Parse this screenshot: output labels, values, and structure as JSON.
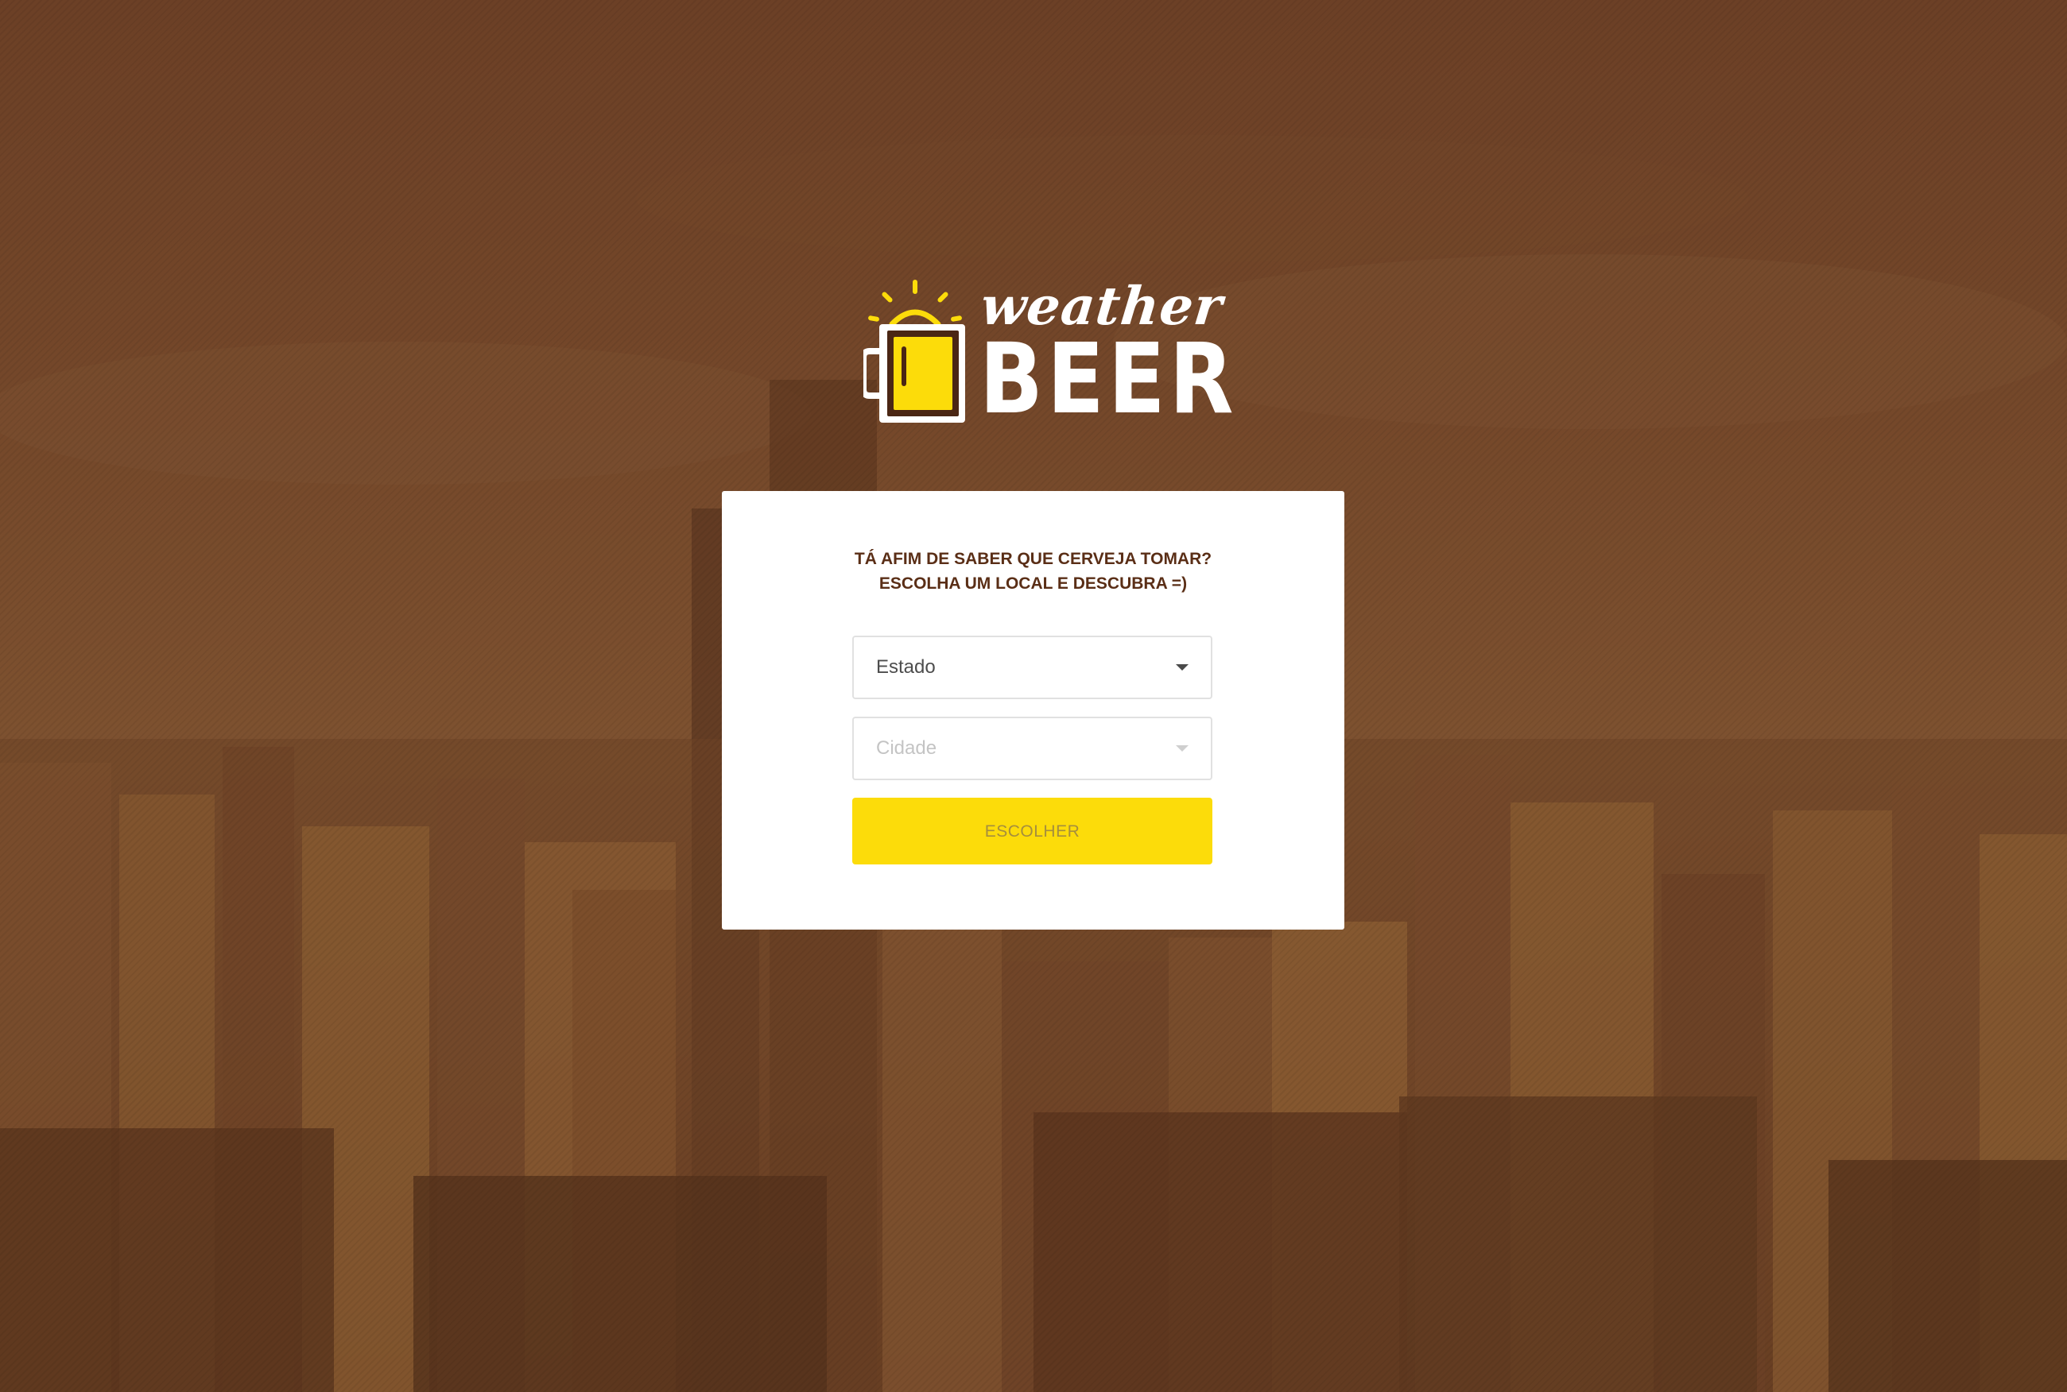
{
  "brand": {
    "word_top": "weather",
    "word_bottom": "BEER",
    "icon": "beer-mug-sun-icon",
    "accent_color": "#fcdc0a",
    "text_color": "#ffffff"
  },
  "form": {
    "prompt_line1": "TÁ AFIM DE SABER QUE CERVEJA TOMAR?",
    "prompt_line2": "ESCOLHA UM LOCAL E DESCUBRA =)",
    "state_select": {
      "value": "Estado",
      "icon": "chevron-down-icon"
    },
    "city_select": {
      "value": "Cidade",
      "icon": "chevron-down-icon",
      "disabled": true
    },
    "submit_label": "ESCOLHER"
  },
  "colors": {
    "background": "#6a3f22",
    "prompt_text": "#5a2e16",
    "button_bg": "#fcdc0a",
    "button_text": "#a58e3d"
  }
}
